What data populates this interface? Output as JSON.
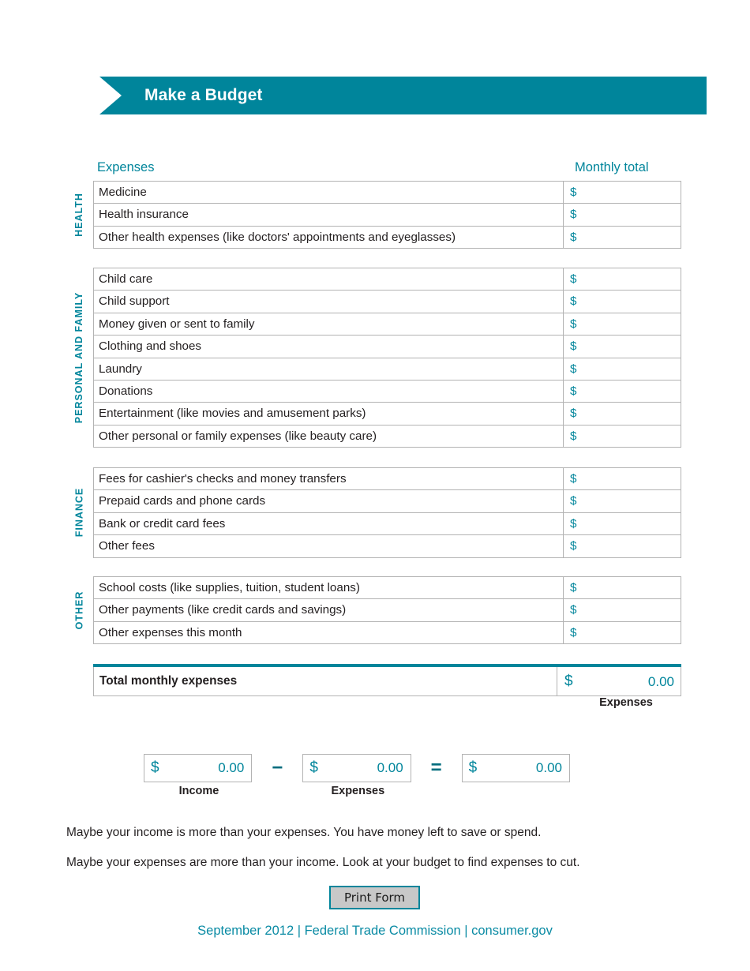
{
  "banner": {
    "title": "Make a Budget"
  },
  "columns": {
    "left": "Expenses",
    "right": "Monthly total"
  },
  "currency_symbol": "$",
  "colors": {
    "teal": "#00859b",
    "text": "#231f20",
    "border": "#b3b3b3",
    "button_face": "#c8c8c8"
  },
  "sections": [
    {
      "label": "HEALTH",
      "rows": [
        {
          "name": "Medicine",
          "amount": ""
        },
        {
          "name": "Health insurance",
          "amount": ""
        },
        {
          "name": "Other health expenses (like doctors' appointments and eyeglasses)",
          "amount": ""
        }
      ]
    },
    {
      "label": "PERSONAL AND FAMILY",
      "rows": [
        {
          "name": "Child care",
          "amount": ""
        },
        {
          "name": "Child support",
          "amount": ""
        },
        {
          "name": "Money given or sent to family",
          "amount": ""
        },
        {
          "name": "Clothing and shoes",
          "amount": ""
        },
        {
          "name": "Laundry",
          "amount": ""
        },
        {
          "name": "Donations",
          "amount": ""
        },
        {
          "name": "Entertainment (like movies and amusement parks)",
          "amount": ""
        },
        {
          "name": "Other personal or family expenses (like beauty care)",
          "amount": ""
        }
      ]
    },
    {
      "label": "FINANCE",
      "rows": [
        {
          "name": "Fees for cashier's checks and money transfers",
          "amount": ""
        },
        {
          "name": "Prepaid cards and phone cards",
          "amount": ""
        },
        {
          "name": "Bank or credit card fees",
          "amount": ""
        },
        {
          "name": "Other fees",
          "amount": ""
        }
      ]
    },
    {
      "label": "OTHER",
      "rows": [
        {
          "name": "School costs (like supplies, tuition, student loans)",
          "amount": ""
        },
        {
          "name": "Other payments (like credit cards and savings)",
          "amount": ""
        },
        {
          "name": "Other expenses this month",
          "amount": ""
        }
      ]
    }
  ],
  "total": {
    "label": "Total monthly expenses",
    "symbol": "$",
    "value": "0.00",
    "caption": "Expenses"
  },
  "calculation": {
    "income": {
      "symbol": "$",
      "value": "0.00",
      "caption": "Income"
    },
    "minus_operator": "−",
    "expenses": {
      "symbol": "$",
      "value": "0.00",
      "caption": "Expenses"
    },
    "equals_operator": "=",
    "result": {
      "symbol": "$",
      "value": "0.00",
      "caption": ""
    }
  },
  "notes": {
    "line1": "Maybe your income is more than your expenses. You have money left to save or spend.",
    "line2": "Maybe your expenses are more than your income. Look at your budget to find expenses to cut."
  },
  "print_button": {
    "label": "Print Form"
  },
  "footer": {
    "text": "September 2012 | Federal Trade Commission | consumer.gov"
  }
}
